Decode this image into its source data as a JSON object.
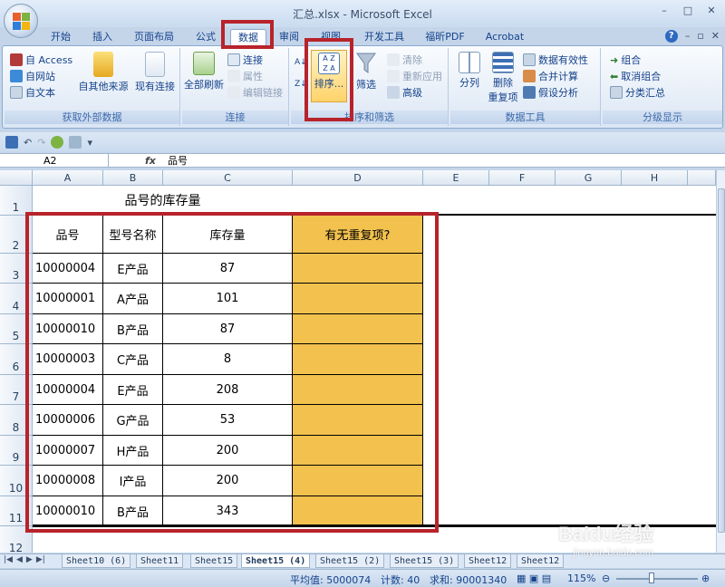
{
  "window": {
    "title": "汇总.xlsx - Microsoft Excel",
    "minimize": "–",
    "restore": "□",
    "close": "✕"
  },
  "ribbon_tabs": [
    {
      "label": "开始"
    },
    {
      "label": "插入"
    },
    {
      "label": "页面布局"
    },
    {
      "label": "公式"
    },
    {
      "label": "数据",
      "active": true
    },
    {
      "label": "审阅"
    },
    {
      "label": "视图"
    },
    {
      "label": "开发工具"
    },
    {
      "label": "福昕PDF"
    },
    {
      "label": "Acrobat"
    }
  ],
  "ribbon": {
    "get_external": {
      "access": "自 Access",
      "web": "自网站",
      "text": "自文本",
      "other": "自其他来源",
      "existing": "现有连接",
      "label": "获取外部数据"
    },
    "connections": {
      "refresh_all": "全部刷新",
      "connections": "连接",
      "properties": "属性",
      "edit_links": "编辑链接",
      "label": "连接"
    },
    "sort_filter": {
      "sort": "排序...",
      "filter": "筛选",
      "clear": "清除",
      "reapply": "重新应用",
      "advanced": "高级",
      "label": "排序和筛选"
    },
    "data_tools": {
      "text_to_columns": "分列",
      "remove_dup_1": "删除",
      "remove_dup_2": "重复项",
      "validation": "数据有效性",
      "consolidate": "合并计算",
      "what_if": "假设分析",
      "label": "数据工具"
    },
    "outline": {
      "group": "组合",
      "ungroup": "取消组合",
      "subtotal": "分类汇总",
      "label": "分级显示"
    }
  },
  "formula_bar": {
    "name_box": "A2",
    "fx": "fx",
    "content": "品号"
  },
  "columns": [
    "A",
    "B",
    "C",
    "D",
    "E",
    "F",
    "G",
    "H"
  ],
  "rows": [
    "1",
    "2",
    "3",
    "4",
    "5",
    "6",
    "7",
    "8",
    "9",
    "10",
    "11",
    "12"
  ],
  "sheet": {
    "title": "品号的库存量",
    "headers": [
      "品号",
      "型号名称",
      "库存量",
      "有无重复项?"
    ],
    "data": [
      [
        "10000004",
        "E产品",
        "87",
        ""
      ],
      [
        "10000001",
        "A产品",
        "101",
        ""
      ],
      [
        "10000010",
        "B产品",
        "87",
        ""
      ],
      [
        "10000003",
        "C产品",
        "8",
        ""
      ],
      [
        "10000004",
        "E产品",
        "208",
        ""
      ],
      [
        "10000006",
        "G产品",
        "53",
        ""
      ],
      [
        "10000007",
        "H产品",
        "200",
        ""
      ],
      [
        "10000008",
        "I产品",
        "200",
        ""
      ],
      [
        "10000010",
        "B产品",
        "343",
        ""
      ]
    ]
  },
  "sheet_tabs": [
    "Sheet10 (6)",
    "Sheet11",
    "Sheet15",
    "Sheet15 (4)",
    "Sheet15 (2)",
    "Sheet15 (3)",
    "Sheet12",
    "Sheet12"
  ],
  "active_sheet_index": 3,
  "status": {
    "average": "平均值: 5000074",
    "count": "计数: 40",
    "sum": "求和: 90001340",
    "zoom": "115%"
  },
  "watermark": {
    "brand": "Baidu经验",
    "url": "jingyan.baidu.com"
  },
  "colors": {
    "highlight_red": "#b8232b",
    "gold_fill": "#f2c14e",
    "ribbon_blue": "#15428b"
  }
}
